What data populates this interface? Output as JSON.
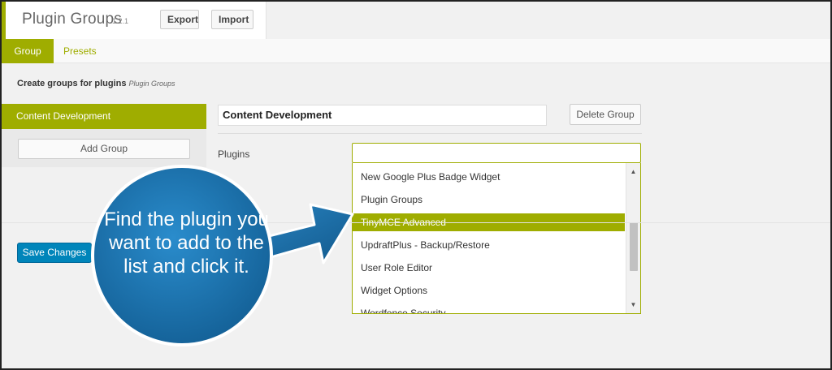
{
  "header": {
    "title": "Plugin Groups",
    "version": "1.2.1",
    "export_label": "Export",
    "import_label": "Import"
  },
  "tabs": [
    {
      "label": "Group",
      "active": true
    },
    {
      "label": "Presets",
      "active": false
    }
  ],
  "page": {
    "subtitle": "Create groups for plugins",
    "subtitle_note": "Plugin Groups"
  },
  "sidebar": {
    "groups": [
      {
        "label": "Content Development",
        "selected": true
      }
    ],
    "add_group_label": "Add Group"
  },
  "editor": {
    "group_name_value": "Content Development",
    "delete_group_label": "Delete Group",
    "plugins_label": "Plugins",
    "plugins_input_value": ""
  },
  "dropdown": {
    "items": [
      {
        "label": "New Google Plus Badge Widget",
        "selected": false
      },
      {
        "label": "Plugin Groups",
        "selected": false
      },
      {
        "label": "TinyMCE Advanced",
        "selected": true
      },
      {
        "label": "UpdraftPlus - Backup/Restore",
        "selected": false
      },
      {
        "label": "User Role Editor",
        "selected": false
      },
      {
        "label": "Widget Options",
        "selected": false
      },
      {
        "label": "Wordfence Security",
        "selected": false
      }
    ]
  },
  "footer": {
    "save_label": "Save Changes"
  },
  "callout": {
    "text": "Find the plugin you want to add to the list and click it."
  },
  "colors": {
    "accent": "#9fad00",
    "primary_button": "#0085ba",
    "callout": "#1a6fa6"
  },
  "icons": {
    "scroll_up": "triangle-up-icon",
    "scroll_down": "triangle-down-icon"
  }
}
